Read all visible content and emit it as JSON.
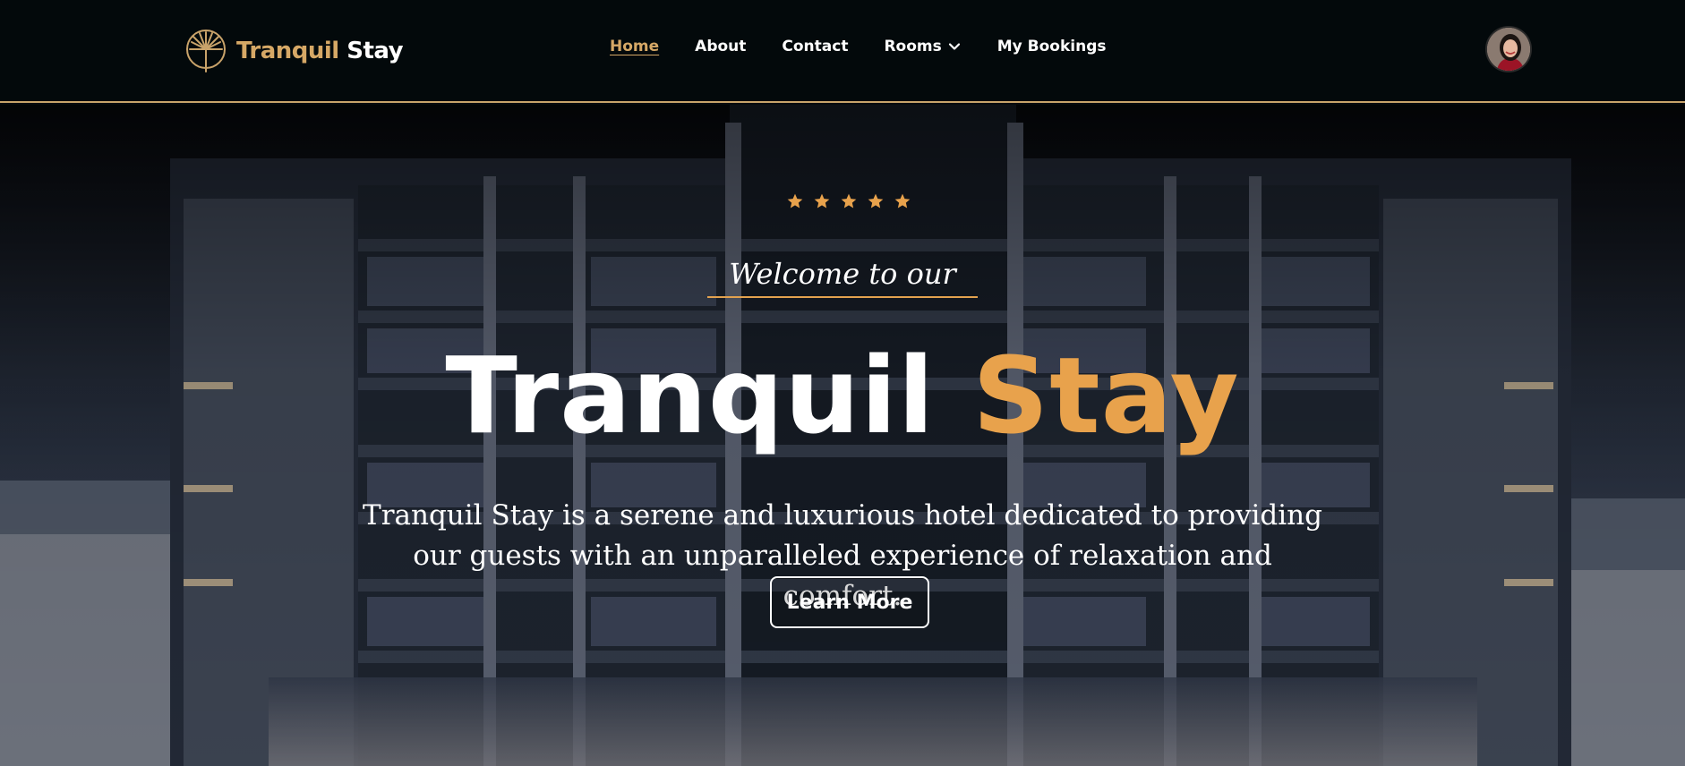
{
  "brand": {
    "name_part1": "Tranquil",
    "name_part2": "Stay",
    "logo_icon": "palm-tree-icon",
    "accent": "#d6a866"
  },
  "nav": {
    "items": [
      {
        "label": "Home",
        "active": true
      },
      {
        "label": "About",
        "active": false
      },
      {
        "label": "Contact",
        "active": false
      },
      {
        "label": "Rooms",
        "active": false,
        "has_dropdown": true
      },
      {
        "label": "My Bookings",
        "active": false
      }
    ]
  },
  "user": {
    "avatar_icon": "user-avatar"
  },
  "hero": {
    "rating_stars": 5,
    "star_color": "#e8a24c",
    "welcome": "Welcome to our",
    "title_part1": "Tranquil",
    "title_part2": "Stay",
    "title_accent": "#e8a24c",
    "description": "Tranquil Stay is a serene and luxurious hotel dedicated to providing our guests with an unparalleled experience of relaxation and comfort.",
    "cta_label": "Learn More"
  }
}
